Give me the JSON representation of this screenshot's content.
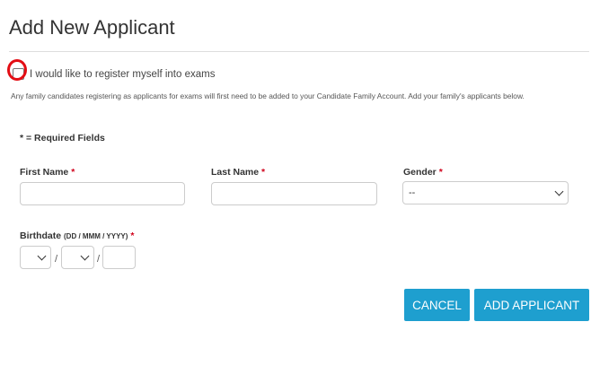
{
  "page": {
    "title": "Add New Applicant"
  },
  "self_register": {
    "label": "I would like to register myself into exams",
    "checked": false
  },
  "help_text": "Any family candidates registering as applicants for exams will first need to be added to your Candidate Family Account. Add your family's applicants below.",
  "required_note": "* = Required Fields",
  "form": {
    "first_name": {
      "label": "First Name",
      "required_mark": "*",
      "value": ""
    },
    "last_name": {
      "label": "Last Name",
      "required_mark": "*",
      "value": ""
    },
    "gender": {
      "label": "Gender",
      "required_mark": "*",
      "selected": "--"
    },
    "birthdate": {
      "label": "Birthdate",
      "format": "(DD / MMM / YYYY)",
      "required_mark": "*",
      "day": "",
      "month": "",
      "year": "",
      "separator": "/"
    }
  },
  "buttons": {
    "cancel": "CANCEL",
    "add_applicant": "ADD APPLICANT"
  },
  "colors": {
    "accent": "#1e9fcf",
    "required": "#d0021b",
    "annotation_circle": "#e30d14"
  },
  "icons": {
    "select_arrow": "chevron-down-icon"
  }
}
